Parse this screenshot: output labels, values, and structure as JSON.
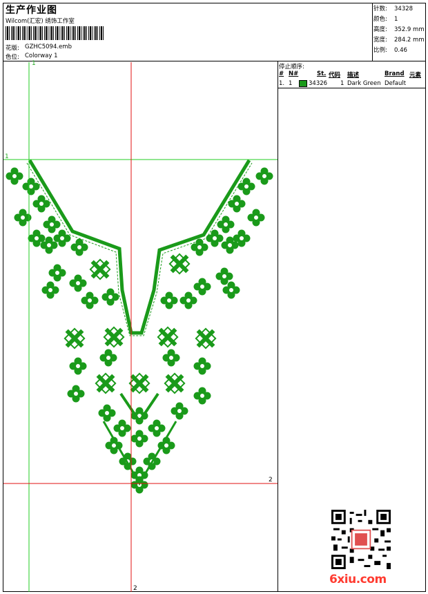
{
  "header": {
    "title": "生产作业图",
    "company": "Wilcom(汇宏) 绣饰工作室",
    "design_label": "花版:",
    "design_file": "GZHC5094.emb",
    "color_label": "色位:",
    "colorway": "Colorway 1"
  },
  "stats": {
    "stitches_label": "针数:",
    "stitches": "34328",
    "colors_label": "颜色:",
    "colors": "1",
    "height_label": "高度:",
    "height": "352.9 mm",
    "width_label": "宽度:",
    "width": "284.2 mm",
    "scale_label": "比例:",
    "scale": "0.46"
  },
  "stop_sequence": {
    "title": "停止顺序:",
    "headers": {
      "num": "#",
      "needle": "N#",
      "st": "St.",
      "code": "代码",
      "desc": "描述",
      "brand": "Brand",
      "element": "元素"
    },
    "rows": [
      {
        "num": "1.",
        "needle": "1",
        "color": "#1a9a1a",
        "st": "34326",
        "code": "1",
        "desc": "Dark Green",
        "brand": "Default"
      }
    ]
  },
  "guides": {
    "green_v": "1",
    "green_h": "1",
    "red_h": "2",
    "red_v": "2",
    "green_color": "#22cc22",
    "red_color": "#e01010"
  },
  "embroidery_color": "#1a9a1a",
  "watermark": {
    "text": "6xiu.com",
    "color": "#ff3b30"
  }
}
